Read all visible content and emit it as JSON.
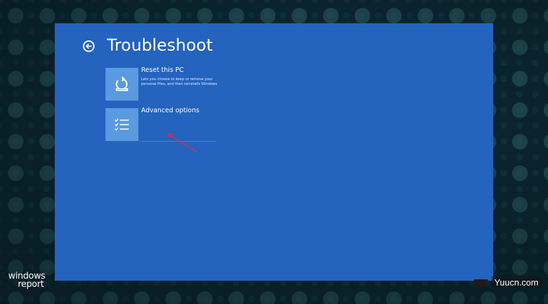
{
  "screen": {
    "title": "Troubleshoot",
    "back_icon": "back-arrow-icon"
  },
  "options": [
    {
      "label": "Reset this PC",
      "description": "Lets you choose to keep or remove your personal files, and then reinstalls Windows",
      "icon": "reset-pc-icon"
    },
    {
      "label": "Advanced options",
      "description": "",
      "icon": "checklist-icon"
    }
  ],
  "annotation": {
    "icon": "pointer-arrow-icon",
    "color": "#d0314e"
  },
  "watermarks": {
    "left_line1": "windows",
    "left_line2": "report",
    "right": "Yuucn.com"
  },
  "colors": {
    "panel": "#2463be",
    "tile": "#5a9ae0",
    "text": "#ffffff"
  }
}
